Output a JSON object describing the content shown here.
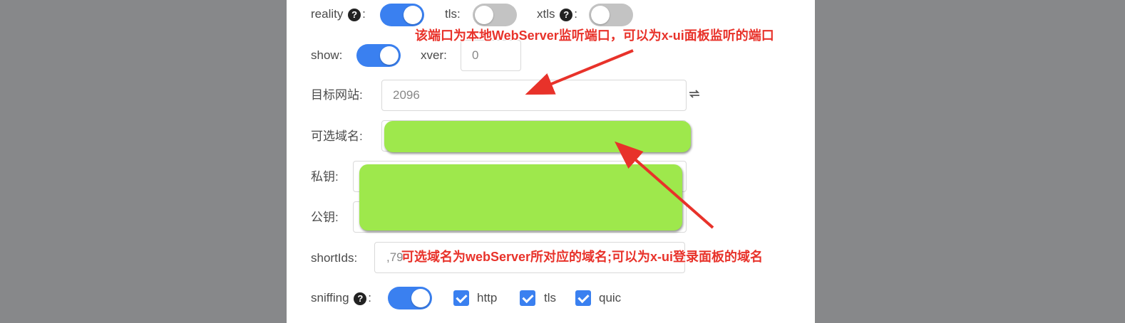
{
  "row1": {
    "reality_label": "reality",
    "tls_label": "tls:",
    "xtls_label": "xtls",
    "colon": ":",
    "help": "?"
  },
  "row2": {
    "show_label": "show:",
    "xver_label": "xver:",
    "xver_value": "0"
  },
  "target": {
    "label": "目标网站:",
    "value": "2096"
  },
  "server_names": {
    "label": "可选域名:"
  },
  "private_key": {
    "label": "私钥:"
  },
  "public_key": {
    "label": "公钥:"
  },
  "short_ids": {
    "label": "shortIds:",
    "value": ",79"
  },
  "sniffing": {
    "label": "sniffing",
    "colon": ":",
    "http": "http",
    "tls": "tls",
    "quic": "quic"
  },
  "annotations": {
    "top": "该端口为本地WebServer监听端口，可以为x-ui面板监听的端口",
    "bottom": "可选域名为webServer所对应的域名;可以为x-ui登录面板的域名"
  },
  "colors": {
    "accent": "#3a80f0",
    "annotation": "#e8322a",
    "redaction": "#9ee84c",
    "backdrop": "#87888a"
  },
  "icons": [
    "help-icon",
    "refresh-icon",
    "check-icon"
  ]
}
